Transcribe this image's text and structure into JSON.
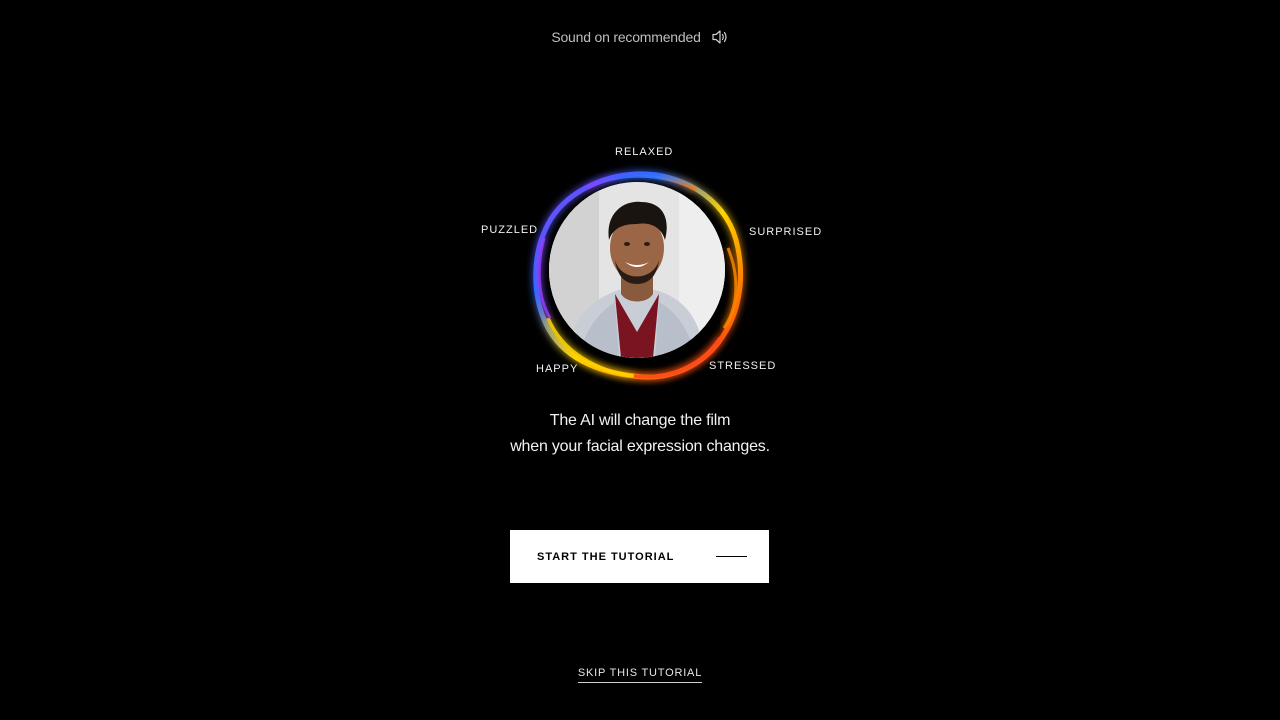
{
  "sound": {
    "label": "Sound on recommended",
    "icon": "speaker-icon"
  },
  "emotions": {
    "relaxed": "RELAXED",
    "surprised": "SURPRISED",
    "puzzled": "PUZZLED",
    "happy": "HAPPY",
    "stressed": "STRESSED"
  },
  "caption": {
    "line1": "The AI will change the film",
    "line2": "when your facial expression changes."
  },
  "start_button": {
    "label": "START THE TUTORIAL"
  },
  "skip_link": {
    "label": "SKIP THIS TUTORIAL"
  },
  "colors": {
    "background": "#000000",
    "button_bg": "#ffffff",
    "ring_blue": "#2f6bff",
    "ring_purple": "#8a3cff",
    "ring_yellow": "#ffd400",
    "ring_orange": "#ff7a00",
    "ring_red": "#ff1a1a"
  }
}
